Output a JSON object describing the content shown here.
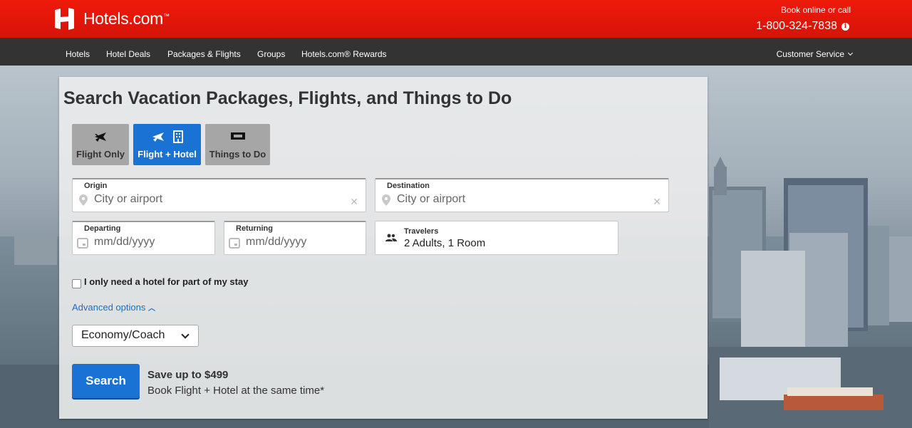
{
  "header": {
    "logo_text": "Hotels.com",
    "logo_trademark": "™",
    "book_label": "Book online or call",
    "phone": "1-800-324-7838"
  },
  "nav": {
    "items": [
      "Hotels",
      "Hotel Deals",
      "Packages & Flights",
      "Groups",
      "Hotels.com® Rewards"
    ],
    "customer_service": "Customer Service"
  },
  "search": {
    "title": "Search Vacation Packages, Flights, and Things to Do",
    "tabs": [
      {
        "label": "Flight Only",
        "active": false
      },
      {
        "label": "Flight + Hotel",
        "active": true
      },
      {
        "label": "Things to Do",
        "active": false
      }
    ],
    "origin": {
      "label": "Origin",
      "placeholder": "City or airport"
    },
    "destination": {
      "label": "Destination",
      "placeholder": "City or airport"
    },
    "departing": {
      "label": "Departing",
      "placeholder": "mm/dd/yyyy"
    },
    "returning": {
      "label": "Returning",
      "placeholder": "mm/dd/yyyy"
    },
    "travelers": {
      "label": "Travelers",
      "value": "2 Adults, 1 Room"
    },
    "partial_stay_label": "I only need a hotel for part of my stay",
    "advanced_options": "Advanced options",
    "cabin_class": "Economy/Coach",
    "search_button": "Search",
    "save_title": "Save up to $499",
    "save_subtitle": "Book Flight + Hotel at the same time*"
  },
  "colors": {
    "brand_red": "#d61308",
    "nav_dark": "#333333",
    "accent_blue": "#1a73d4",
    "link_blue": "#1a6fc9"
  }
}
